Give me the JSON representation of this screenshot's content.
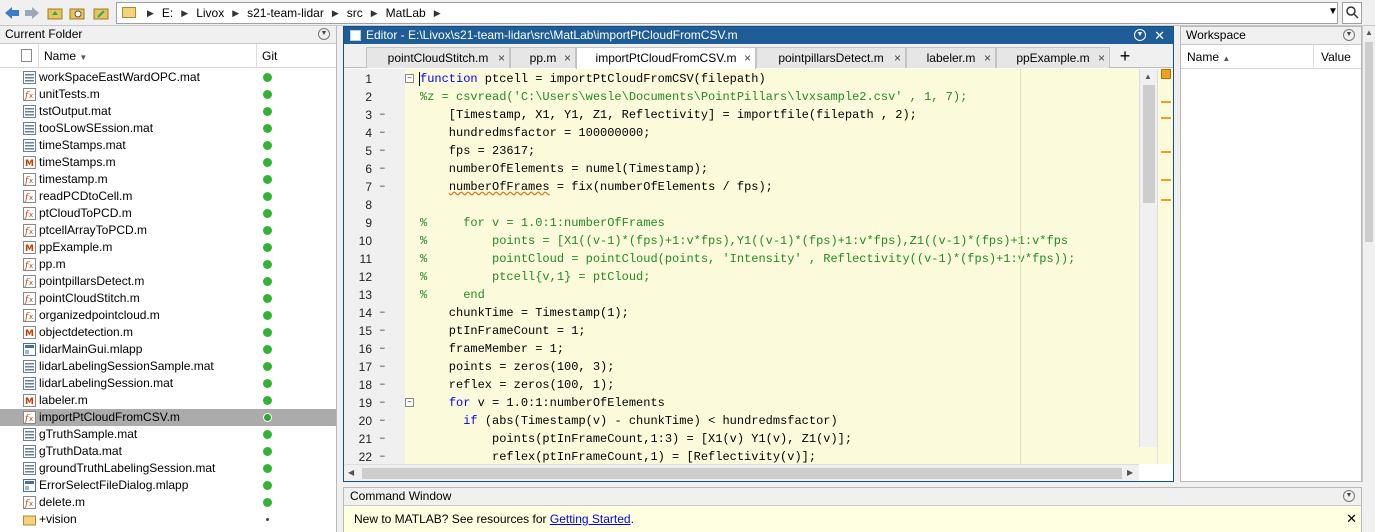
{
  "address": {
    "crumbs": [
      "E:",
      "Livox",
      "s21-team-lidar",
      "src",
      "MatLab"
    ]
  },
  "current_folder": {
    "title": "Current Folder",
    "col_name": "Name",
    "col_git": "Git",
    "files": [
      {
        "name": "workSpaceEastWardOPC.mat",
        "type": "mat"
      },
      {
        "name": "unitTests.m",
        "type": "func"
      },
      {
        "name": "tstOutput.mat",
        "type": "mat"
      },
      {
        "name": "tooSLowSEssion.mat",
        "type": "mat"
      },
      {
        "name": "timeStamps.mat",
        "type": "mat"
      },
      {
        "name": "timeStamps.m",
        "type": "script"
      },
      {
        "name": "timestamp.m",
        "type": "func"
      },
      {
        "name": "readPCDtoCell.m",
        "type": "func"
      },
      {
        "name": "ptCloudToPCD.m",
        "type": "func"
      },
      {
        "name": "ptcellArrayToPCD.m",
        "type": "func"
      },
      {
        "name": "ppExample.m",
        "type": "script"
      },
      {
        "name": "pp.m",
        "type": "func"
      },
      {
        "name": "pointpillarsDetect.m",
        "type": "func"
      },
      {
        "name": "pointCloudStitch.m",
        "type": "func"
      },
      {
        "name": "organizedpointcloud.m",
        "type": "func"
      },
      {
        "name": "objectdetection.m",
        "type": "script"
      },
      {
        "name": "lidarMainGui.mlapp",
        "type": "app"
      },
      {
        "name": "lidarLabelingSessionSample.mat",
        "type": "mat"
      },
      {
        "name": "lidarLabelingSession.mat",
        "type": "mat"
      },
      {
        "name": "labeler.m",
        "type": "script"
      },
      {
        "name": "importPtCloudFromCSV.m",
        "type": "func"
      },
      {
        "name": "gTruthSample.mat",
        "type": "mat"
      },
      {
        "name": "gTruthData.mat",
        "type": "mat"
      },
      {
        "name": "groundTruthLabelingSession.mat",
        "type": "mat"
      },
      {
        "name": "ErrorSelectFileDialog.mlapp",
        "type": "app"
      },
      {
        "name": "delete.m",
        "type": "func"
      },
      {
        "name": "+vision",
        "type": "folder"
      }
    ],
    "selected_file": "importPtCloudFromCSV.m"
  },
  "editor": {
    "title": "Editor - E:\\Livox\\s21-team-lidar\\src\\MatLab\\importPtCloudFromCSV.m",
    "tabs": [
      "pointCloudStitch.m",
      "pp.m",
      "importPtCloudFromCSV.m",
      "pointpillarsDetect.m",
      "labeler.m",
      "ppExample.m"
    ],
    "active_tab": "importPtCloudFromCSV.m",
    "lines": [
      {
        "n": "1",
        "dash": "",
        "fold": "−",
        "code": "<span class=\"kw\">function</span> ptcell = importPtCloudFromCSV(filepath)"
      },
      {
        "n": "2",
        "dash": "",
        "fold": "",
        "code": "<span class=\"cm\">%z = csvread('C:\\Users\\wesle\\Documents\\PointPillars\\lvxsample2.csv' , 1, 7);</span>"
      },
      {
        "n": "3",
        "dash": "–",
        "fold": "",
        "code": "    [Timestamp, X1, Y1, Z1, Reflectivity] = importfile(filepath , 2);"
      },
      {
        "n": "4",
        "dash": "–",
        "fold": "",
        "code": "    hundredmsfactor = 100000000;"
      },
      {
        "n": "5",
        "dash": "–",
        "fold": "",
        "code": "    fps = 23617;"
      },
      {
        "n": "6",
        "dash": "–",
        "fold": "",
        "code": "    numberOfElements = numel(Timestamp);"
      },
      {
        "n": "7",
        "dash": "–",
        "fold": "",
        "code": "    <span class=\"sq\">numberOfFrames</span> = fix(numberOfElements / fps);"
      },
      {
        "n": "8",
        "dash": "",
        "fold": "",
        "code": ""
      },
      {
        "n": "9",
        "dash": "",
        "fold": "",
        "code": "<span class=\"cm\">%     for v = 1.0:1:numberOfFrames</span>"
      },
      {
        "n": "10",
        "dash": "",
        "fold": "",
        "code": "<span class=\"cm\">%         points = [X1((v-1)*(fps)+1:v*fps),Y1((v-1)*(fps)+1:v*fps),Z1((v-1)*(fps)+1:v*fps</span>"
      },
      {
        "n": "11",
        "dash": "",
        "fold": "",
        "code": "<span class=\"cm\">%         pointCloud = pointCloud(points, 'Intensity' , Reflectivity((v-1)*(fps)+1:v*fps));</span>"
      },
      {
        "n": "12",
        "dash": "",
        "fold": "",
        "code": "<span class=\"cm\">%         ptcell{v,1} = ptCloud;</span>"
      },
      {
        "n": "13",
        "dash": "",
        "fold": "",
        "code": "<span class=\"cm\">%     end</span>"
      },
      {
        "n": "14",
        "dash": "–",
        "fold": "",
        "code": "    chunkTime = Timestamp(1);"
      },
      {
        "n": "15",
        "dash": "–",
        "fold": "",
        "code": "    ptInFrameCount = 1;"
      },
      {
        "n": "16",
        "dash": "–",
        "fold": "",
        "code": "    frameMember = 1;"
      },
      {
        "n": "17",
        "dash": "–",
        "fold": "",
        "code": "    points = zeros(100, 3);"
      },
      {
        "n": "18",
        "dash": "–",
        "fold": "",
        "code": "    reflex = zeros(100, 1);"
      },
      {
        "n": "19",
        "dash": "–",
        "fold": "−",
        "code": "    <span class=\"kw\">for</span> v = 1.0:1:numberOfElements"
      },
      {
        "n": "20",
        "dash": "–",
        "fold": "",
        "code": "      <span class=\"kw\">if</span> (abs(Timestamp(v) - chunkTime) &lt; hundredmsfactor)"
      },
      {
        "n": "21",
        "dash": "–",
        "fold": "",
        "code": "          points(ptInFrameCount,1:3) = [X1(v) Y1(v), Z1(v)];"
      },
      {
        "n": "22",
        "dash": "–",
        "fold": "",
        "code": "          reflex(ptInFrameCount,1) = [Reflectivity(v)];"
      }
    ]
  },
  "workspace": {
    "title": "Workspace",
    "col_name": "Name",
    "col_value": "Value"
  },
  "command_window": {
    "title": "Command Window",
    "notice": "New to MATLAB? See resources for ",
    "link": "Getting Started",
    "notice_end": "."
  },
  "colors": {
    "editor_title_bg": "#1f5d99",
    "code_bg": "#fbfbdc",
    "git_ok": "#34b233",
    "keyword": "#0000ff",
    "comment": "#228b22"
  }
}
